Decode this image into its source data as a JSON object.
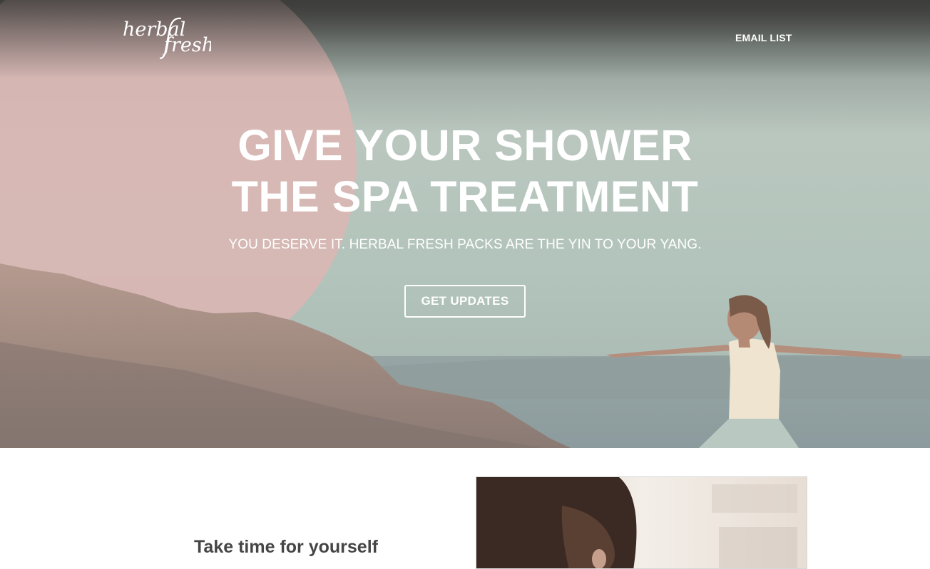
{
  "brand": {
    "logo_word_1": "herbal",
    "logo_word_2": "fresh"
  },
  "nav": {
    "email_list_label": "EMAIL LIST"
  },
  "hero": {
    "headline_line_1": "GIVE YOUR SHOWER",
    "headline_line_2": "THE SPA TREATMENT",
    "subheadline": "YOU DESERVE IT. HERBAL FRESH PACKS ARE THE YIN TO YOUR YANG.",
    "cta_label": "GET UPDATES"
  },
  "feature": {
    "heading": "Take time for yourself"
  },
  "colors": {
    "text_on_hero": "#ffffff",
    "pink_accent": "#d9b6b3",
    "body_text": "#454545"
  }
}
